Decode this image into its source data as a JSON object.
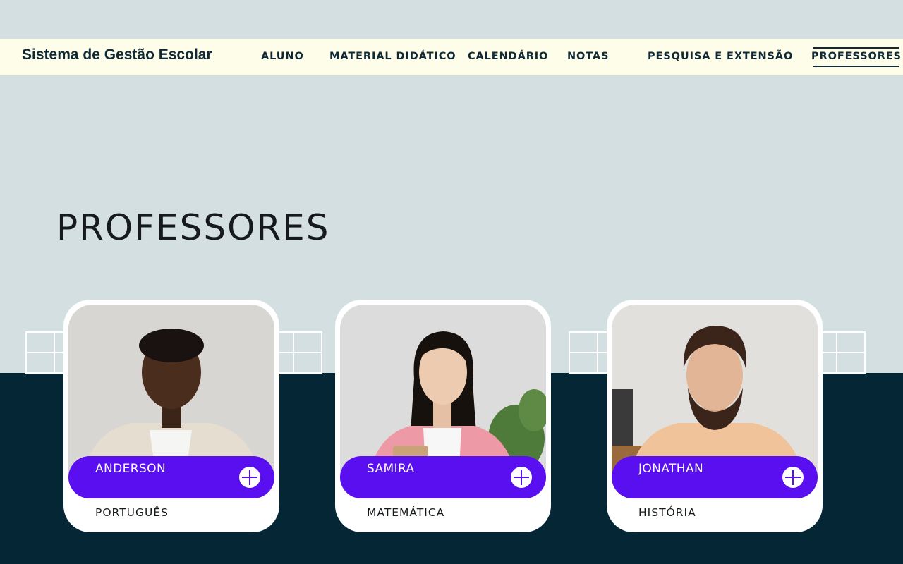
{
  "header": {
    "brand": "Sistema de Gestão Escolar",
    "nav": [
      {
        "label": "ALUNO"
      },
      {
        "label": "MATERIAL DIDÁTICO"
      },
      {
        "label": "CALENDÁRIO"
      },
      {
        "label": "NOTAS"
      },
      {
        "label": "PESQUISA E EXTENSÃO"
      },
      {
        "label": "PROFESSORES",
        "active": true
      }
    ]
  },
  "main": {
    "title": "PROFESSORES",
    "teachers": [
      {
        "name": "ANDERSON",
        "subject": "PORTUGUÊS",
        "icon": "plus-icon"
      },
      {
        "name": "SAMIRA",
        "subject": "MATEMÁTICA",
        "icon": "plus-icon"
      },
      {
        "name": "JONATHAN",
        "subject": "HISTÓRIA",
        "icon": "plus-icon"
      }
    ]
  },
  "colors": {
    "background": "#d3dfe0",
    "header_bg": "#fdfdea",
    "dark_band": "#052635",
    "accent": "#5a0ff1",
    "text_dark": "#0f2a36"
  }
}
